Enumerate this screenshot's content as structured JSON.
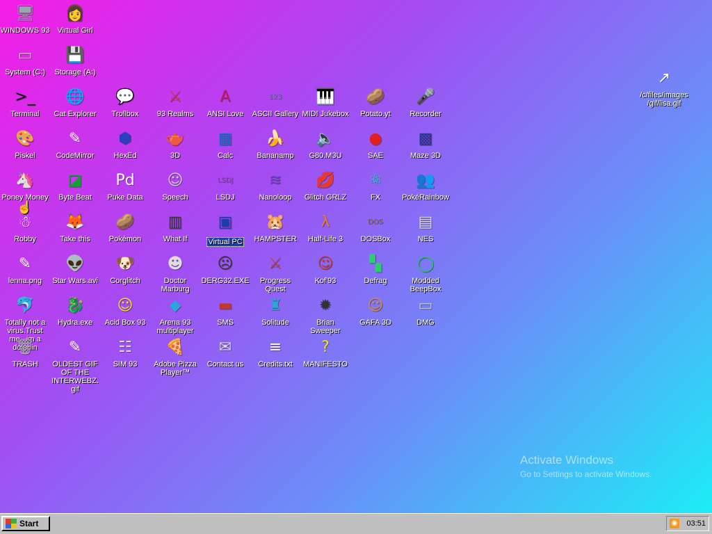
{
  "desktop": {
    "icons": [
      {
        "label": "WINDOWS 93",
        "glyph": "🖥",
        "color": "#9aa6b2"
      },
      {
        "label": "Virtual Girl",
        "glyph": "👩",
        "color": "#d8a68a"
      },
      {
        "label": "System (C:)",
        "glyph": "▭",
        "color": "#c8c8c8"
      },
      {
        "label": "Storage (A:)",
        "glyph": "💾",
        "color": "#9aa6b2"
      },
      {
        "label": "Terminal",
        "glyph": ">_",
        "color": "#000000"
      },
      {
        "label": "Cat Explorer",
        "glyph": "🌐",
        "color": "#3b7dd8"
      },
      {
        "label": "Trollbox",
        "glyph": "💬",
        "color": "#2aa6d8"
      },
      {
        "label": "93 Realms",
        "glyph": "⚔",
        "color": "#c0392b"
      },
      {
        "label": "ANSI Love",
        "glyph": "A",
        "color": "#c2185b"
      },
      {
        "label": "ASCII Gallery",
        "glyph": "123",
        "color": "#27ae60"
      },
      {
        "label": "MIDI Jukebox",
        "glyph": "🎹",
        "color": "#222222"
      },
      {
        "label": "Potato.yt",
        "glyph": "🥔",
        "color": "#b07a3a"
      },
      {
        "label": "Recorder",
        "glyph": "🎤",
        "color": "#555555"
      },
      {
        "label": "Piskel",
        "glyph": "🎨",
        "color": "#d4a04c"
      },
      {
        "label": "CodeMirror",
        "glyph": "✎",
        "color": "#ffffff"
      },
      {
        "label": "HexEd",
        "glyph": "⬢",
        "color": "#2b3fbf"
      },
      {
        "label": "3D",
        "glyph": "🫖",
        "color": "#e8a0c8"
      },
      {
        "label": "Calc",
        "glyph": "▦",
        "color": "#1a6dcc"
      },
      {
        "label": "Bananamp",
        "glyph": "🍌",
        "color": "#f1d21a"
      },
      {
        "label": "G80.M3U",
        "glyph": "🔈",
        "color": "#ffffff"
      },
      {
        "label": "SAE",
        "glyph": "●",
        "color": "#e02020"
      },
      {
        "label": "Maze 3D",
        "glyph": "▩",
        "color": "#27318a"
      },
      {
        "label": "Poney Money",
        "glyph": "🦄",
        "color": "#b06ad8"
      },
      {
        "label": "Byte Beat",
        "glyph": "◪",
        "color": "#14a030"
      },
      {
        "label": "Puke Data",
        "glyph": "Pd",
        "color": "#ffffff"
      },
      {
        "label": "Speech",
        "glyph": "☺",
        "color": "#cfcfcf"
      },
      {
        "label": "LSDJ",
        "glyph": "LSDJ",
        "color": "#8e44ad"
      },
      {
        "label": "Nanoloop",
        "glyph": "≋",
        "color": "#6a3fbf"
      },
      {
        "label": "Glitch GRLZ",
        "glyph": "💋",
        "color": "#e0245e"
      },
      {
        "label": "FX",
        "glyph": "⚛",
        "color": "#26d4d0"
      },
      {
        "label": "PokéRainbow",
        "glyph": "👥",
        "color": "#6b8e3a"
      },
      {
        "label": "Robby",
        "glyph": "☃",
        "color": "#ffffff"
      },
      {
        "label": "Take this",
        "glyph": "🦊",
        "color": "#e67e22"
      },
      {
        "label": "Pokémon",
        "glyph": "🥔",
        "color": "#b07a3a"
      },
      {
        "label": "What If",
        "glyph": "▥",
        "color": "#3a3a3a"
      },
      {
        "label": "Virtual PC",
        "glyph": "▣",
        "color": "#1b3fa8"
      },
      {
        "label": "HAMPSTER",
        "glyph": "🐹",
        "color": "#dddddd"
      },
      {
        "label": "Half-Life 3",
        "glyph": "λ",
        "color": "#e67e22"
      },
      {
        "label": "DOSBox",
        "glyph": "DOS",
        "color": "#8a6a2a"
      },
      {
        "label": "NES",
        "glyph": "▤",
        "color": "#dddddd"
      },
      {
        "label": "lenna.png",
        "glyph": "✎",
        "color": "#ffffff"
      },
      {
        "label": "Star Wars.avi",
        "glyph": "👽",
        "color": "#4a8a2a"
      },
      {
        "label": "Corglitch",
        "glyph": "🐶",
        "color": "#d98c3a"
      },
      {
        "label": "Doctor Marburg",
        "glyph": "☻",
        "color": "#dddddd"
      },
      {
        "label": "DERG32.EXE",
        "glyph": "☹",
        "color": "#333333"
      },
      {
        "label": "Progress Quest",
        "glyph": "⚔",
        "color": "#c0392b"
      },
      {
        "label": "Kof'93",
        "glyph": "☺",
        "color": "#c0392b"
      },
      {
        "label": "Defrag",
        "glyph": "▚",
        "color": "#2ecc71"
      },
      {
        "label": "Modded BeepBox",
        "glyph": "◯",
        "color": "#22c55e"
      },
      {
        "label": "Totally not a virus.Trust me...im a dolphin",
        "glyph": "🐬",
        "color": "#2aa6d8"
      },
      {
        "label": "Hydra.exe",
        "glyph": "🐉",
        "color": "#2f8a3a"
      },
      {
        "label": "Acid Box 93",
        "glyph": "☺",
        "color": "#f1e21a"
      },
      {
        "label": "Arena 93 multiplayer",
        "glyph": "◆",
        "color": "#2aa6d8"
      },
      {
        "label": "SMS",
        "glyph": "▬",
        "color": "#c0392b"
      },
      {
        "label": "Solitude",
        "glyph": "♜",
        "color": "#2aa6d8"
      },
      {
        "label": "Brian Sweeper",
        "glyph": "✹",
        "color": "#333333"
      },
      {
        "label": "GAFA 3D",
        "glyph": "☺",
        "color": "#d98c3a"
      },
      {
        "label": "DMG",
        "glyph": "▭",
        "color": "#cccccc"
      },
      {
        "label": "TRASH",
        "glyph": "🗑",
        "color": "#aaaaaa"
      },
      {
        "label": "OLDEST GIF OF THE INTERWEBZ.gif",
        "glyph": "✎",
        "color": "#ffffff"
      },
      {
        "label": "SIM 93",
        "glyph": "☷",
        "color": "#dddddd"
      },
      {
        "label": "Adobe Pizza Player™",
        "glyph": "🍕",
        "color": "#e0a040"
      },
      {
        "label": "Contact us",
        "glyph": "✉",
        "color": "#dddddd"
      },
      {
        "label": "Credits.txt",
        "glyph": "≡",
        "color": "#ffffff"
      },
      {
        "label": "MANIFESTO",
        "glyph": "?",
        "color": "#f1e21a"
      },
      {
        "label": "/c/files/images/gif/lisa.gif",
        "glyph": "↗",
        "color": "#ffffff"
      }
    ],
    "selected_label": "Virtual PC"
  },
  "watermark": {
    "title": "Activate Windows",
    "subtitle": "Go to Settings to activate Windows."
  },
  "taskbar": {
    "start_label": "Start",
    "clock": "03:51",
    "tray_icon": "rss-icon"
  },
  "colors": {
    "gradient_start": "#f51ce6",
    "gradient_end": "#18f2f6",
    "taskbar": "#c0c0c0",
    "selection": "#1b3fa8"
  }
}
